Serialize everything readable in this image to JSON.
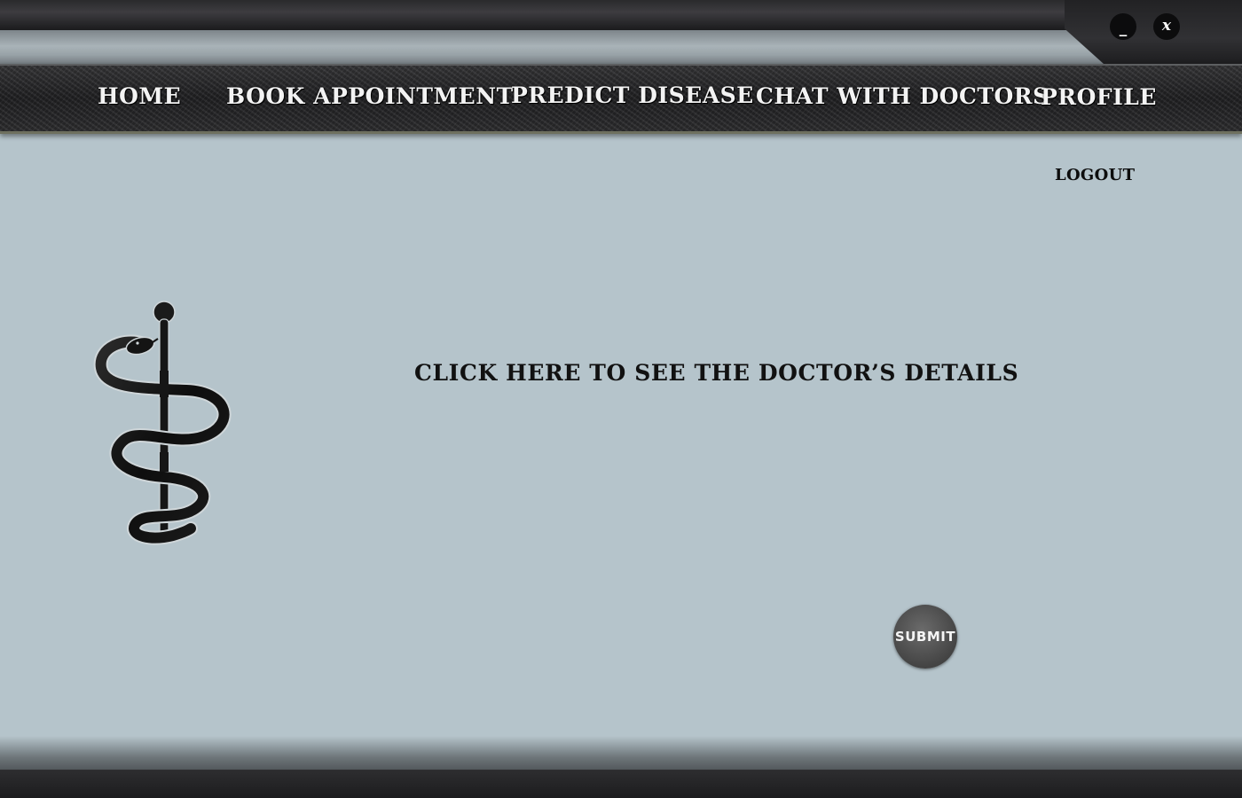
{
  "window": {
    "minimize_label": "_",
    "close_label": "x"
  },
  "nav": {
    "items": [
      {
        "label": "Home"
      },
      {
        "label": "Book Appointment"
      },
      {
        "label": "Predict Disease"
      },
      {
        "label": "Chat with Doctors"
      },
      {
        "label": "Profile"
      }
    ]
  },
  "header": {
    "logout_label": "LOGOUT"
  },
  "main": {
    "logo_icon": "rod-of-asclepius-icon",
    "details_link": "Click here to see the doctor’s details",
    "submit_label": "Submit"
  },
  "colors": {
    "background": "#b5c4cb",
    "nav_bar": "#2a2a2c",
    "nav_text": "#f3f3f3",
    "text_dark": "#111111",
    "submit_button": "#4a4a4a"
  }
}
